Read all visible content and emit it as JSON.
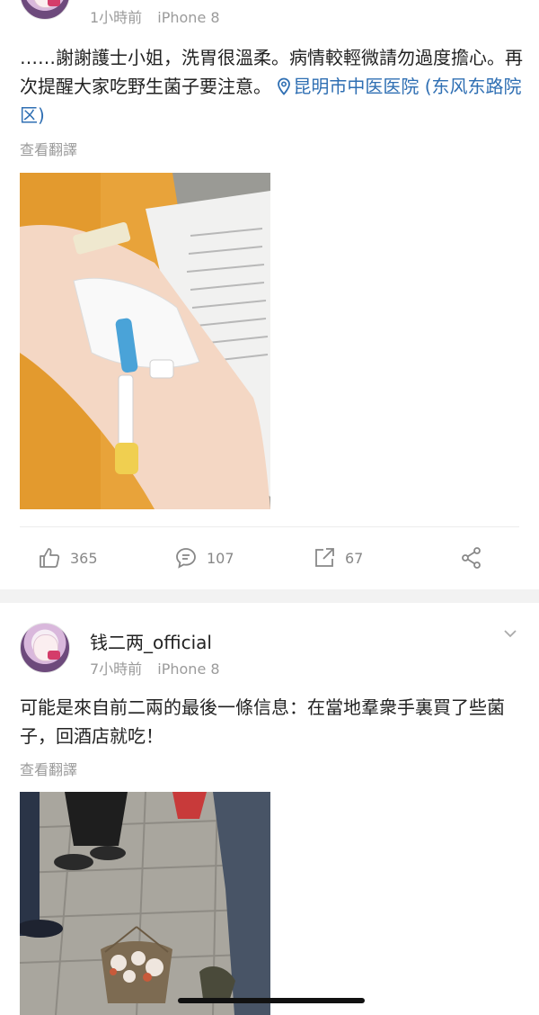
{
  "post1": {
    "time": "1小時前",
    "device": "iPhone 8",
    "text": "……謝謝護士小姐，洗胃很溫柔。病情較輕微請勿過度擔心。再次提醒大家吃野生菌子要注意。",
    "location": "昆明市中医医院 (东风东路院区)",
    "translate": "查看翻譯",
    "actions": {
      "likes": "365",
      "comments": "107",
      "reposts": "67"
    }
  },
  "post2": {
    "username": "钱二两_official",
    "time": "7小時前",
    "device": "iPhone 8",
    "text": "可能是來自前二兩的最後一條信息：在當地羣衆手裏買了些菌子，回酒店就吃！",
    "translate": "查看翻譯"
  },
  "colors": {
    "link": "#2f6fb3",
    "meta": "#9b9b9b",
    "separator": "#f2f2f2"
  },
  "icons": [
    "like-icon",
    "comment-icon",
    "repost-icon",
    "share-icon",
    "location-pin-icon",
    "chevron-down-icon"
  ]
}
